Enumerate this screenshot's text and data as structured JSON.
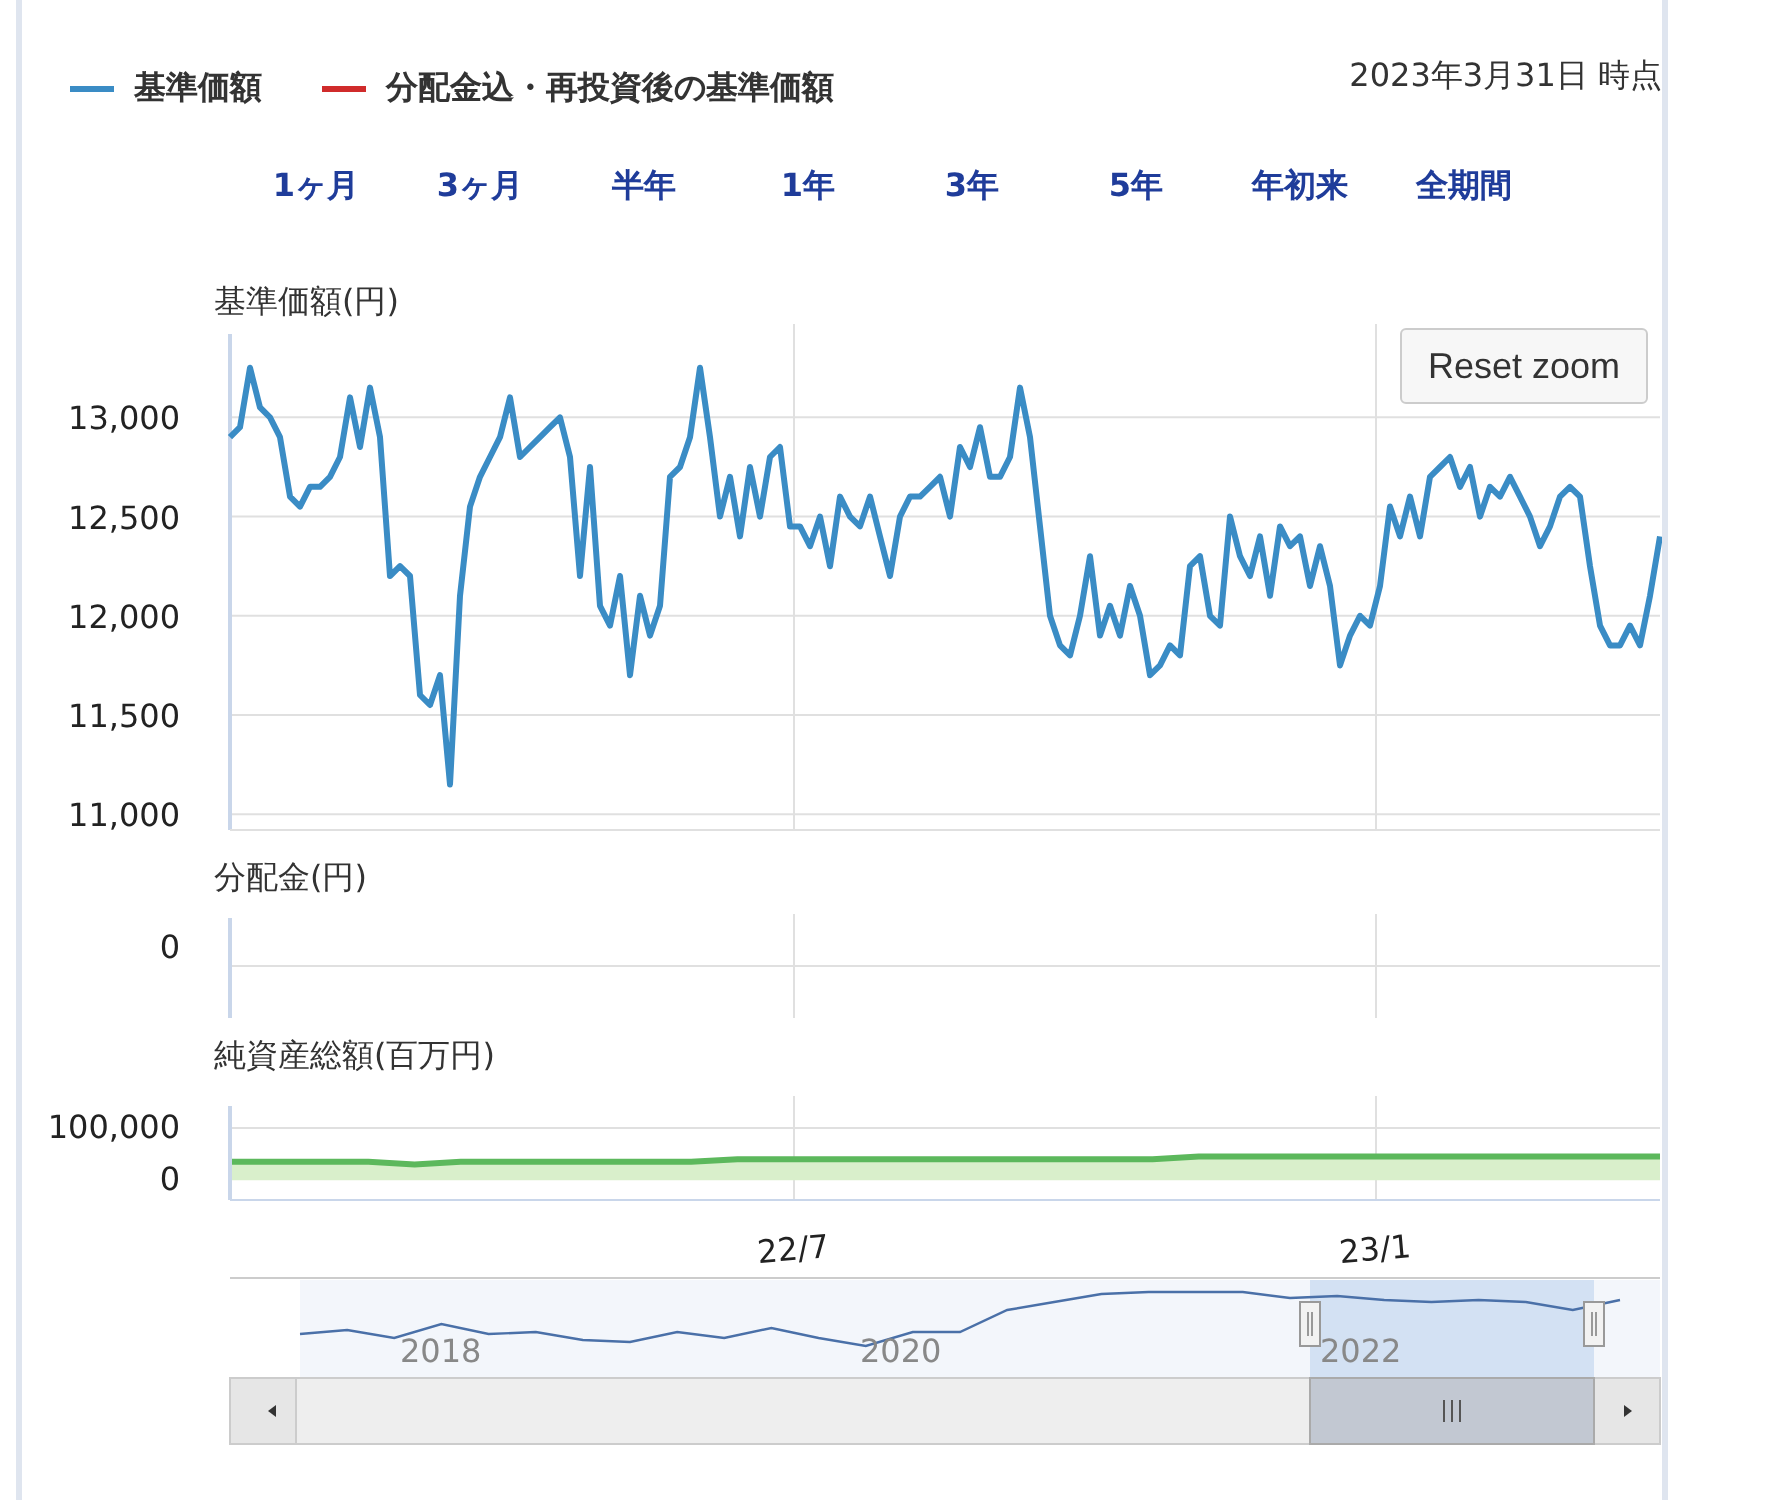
{
  "legend": [
    {
      "label": "基準価額",
      "color": "#3a8cc5"
    },
    {
      "label": "分配金込・再投資後の基準価額",
      "color": "#d02b2b"
    }
  ],
  "as_of": "2023年3月31日 時点",
  "range_buttons": [
    {
      "label": "1ヶ月"
    },
    {
      "label": "3ヶ月"
    },
    {
      "label": "半年"
    },
    {
      "label": "1年"
    },
    {
      "label": "3年"
    },
    {
      "label": "5年"
    },
    {
      "label": "年初来"
    },
    {
      "label": "全期間"
    }
  ],
  "price_chart": {
    "title": "基準価額(円)",
    "reset_button": "Reset zoom",
    "chart_data": {
      "type": "line",
      "grid": true,
      "ylim": [
        10920,
        13420
      ],
      "yticks": [
        {
          "value": 11000,
          "label": "11,000"
        },
        {
          "value": 11500,
          "label": "11,500"
        },
        {
          "value": 12000,
          "label": "12,000"
        },
        {
          "value": 12500,
          "label": "12,500"
        },
        {
          "value": 13000,
          "label": "13,000"
        }
      ],
      "values": [
        12900,
        12950,
        13250,
        13050,
        13000,
        12900,
        12600,
        12550,
        12650,
        12650,
        12700,
        12800,
        13100,
        12850,
        13150,
        12900,
        12200,
        12250,
        12200,
        11600,
        11550,
        11700,
        11150,
        12100,
        12550,
        12700,
        12800,
        12900,
        13100,
        12800,
        12850,
        12900,
        12950,
        13000,
        12800,
        12200,
        12750,
        12050,
        11950,
        12200,
        11700,
        12100,
        11900,
        12050,
        12700,
        12750,
        12900,
        13250,
        12900,
        12500,
        12700,
        12400,
        12750,
        12500,
        12800,
        12850,
        12450,
        12450,
        12350,
        12500,
        12250,
        12600,
        12500,
        12450,
        12600,
        12400,
        12200,
        12500,
        12600,
        12600,
        12650,
        12700,
        12500,
        12850,
        12750,
        12950,
        12700,
        12700,
        12800,
        13150,
        12900,
        12450,
        12000,
        11850,
        11800,
        12000,
        12300,
        11900,
        12050,
        11900,
        12150,
        12000,
        11700,
        11750,
        11850,
        11800,
        12250,
        12300,
        12000,
        11950,
        12500,
        12300,
        12200,
        12400,
        12100,
        12450,
        12350,
        12400,
        12150,
        12350,
        12150,
        11750,
        11900,
        12000,
        11950,
        12150,
        12550,
        12400,
        12600,
        12400,
        12700,
        12750,
        12800,
        12650,
        12750,
        12500,
        12650,
        12600,
        12700,
        12600,
        12500,
        12350,
        12450,
        12600,
        12650,
        12600,
        12250,
        11950,
        11850,
        11850,
        11950,
        11850,
        12100,
        12400
      ]
    }
  },
  "distribution_chart": {
    "title": "分配金(円)",
    "y_tick": "0"
  },
  "net_assets_chart": {
    "title": "純資産総額(百万円)",
    "chart_data": {
      "type": "area",
      "ylim": [
        -38000,
        142000
      ],
      "yticks": [
        {
          "value": 0,
          "label": "0"
        },
        {
          "value": 100000,
          "label": "100,000"
        }
      ],
      "values": [
        35000,
        35000,
        35000,
        35000,
        30000,
        35000,
        35000,
        35000,
        35000,
        35000,
        35000,
        40000,
        40000,
        40000,
        40000,
        40000,
        40000,
        40000,
        40000,
        40000,
        40000,
        45000,
        45000,
        45000,
        45000,
        45000,
        45000,
        45000,
        45000,
        45000,
        45000,
        45000
      ]
    }
  },
  "x_axis_labels": [
    "22/7",
    "23/1"
  ],
  "navigator": {
    "year_labels": [
      "2018",
      "2020",
      "2022"
    ]
  }
}
